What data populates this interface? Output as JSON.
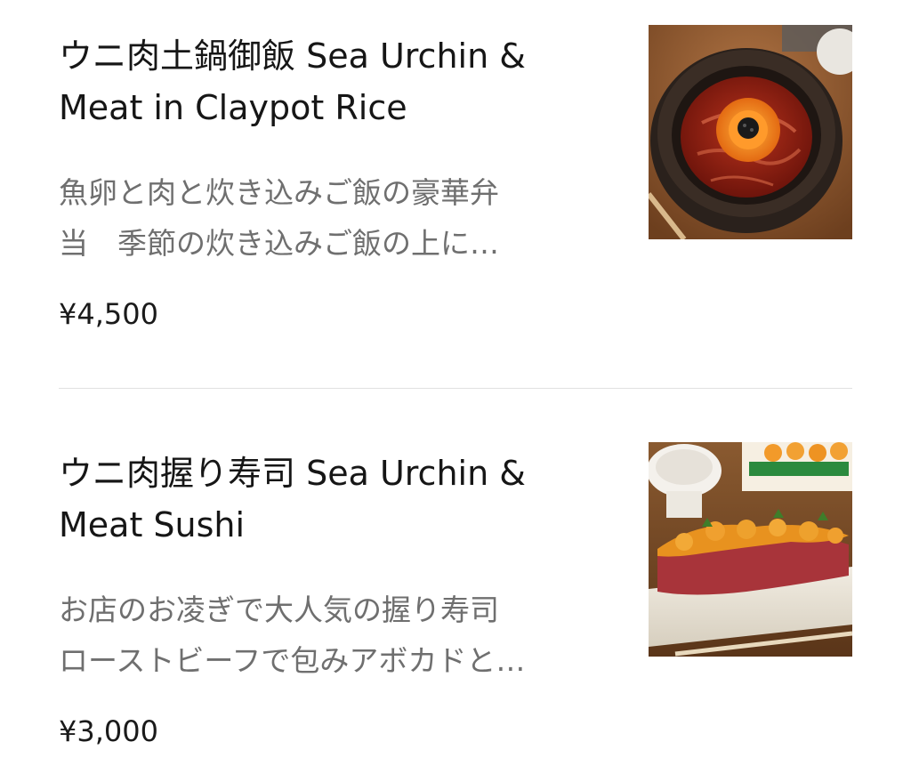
{
  "menu": {
    "items": [
      {
        "title": "ウニ肉土鍋御飯 Sea Urchin & Meat in Claypot Rice",
        "description_lines": [
          "魚卵と肉と炊き込みご飯の豪華弁",
          "当　季節の炊き込みご飯の上に…"
        ],
        "price": "¥4,500",
        "image_icon": "claypot-rice-photo"
      },
      {
        "title": "ウニ肉握り寿司 Sea Urchin & Meat Sushi",
        "description_lines": [
          "お店のお凌ぎで大人気の握り寿司",
          "ローストビーフで包みアボカドと…"
        ],
        "price": "¥3,000",
        "image_icon": "sushi-platter-photo"
      }
    ]
  },
  "colors": {
    "title_text": "#161616",
    "description_text": "#6f6f6f",
    "price_text": "#1a1a1a",
    "divider": "#e1e1e1",
    "background": "#ffffff"
  }
}
